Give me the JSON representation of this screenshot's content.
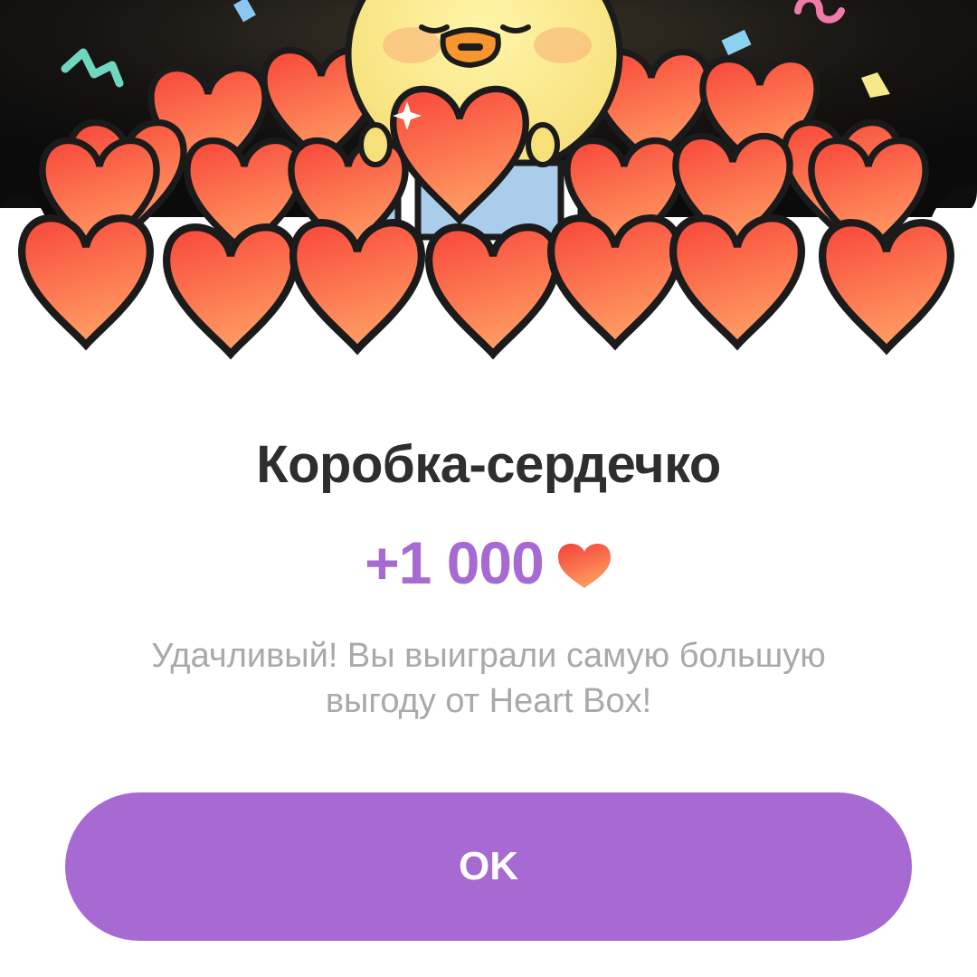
{
  "dialog": {
    "title": "Коробка-сердечко",
    "reward_amount": "+1 000",
    "reward_icon": "heart-icon",
    "message_line1": "Удачливый! Вы выиграли самую большую",
    "message_line2": "выгоду от Heart Box!",
    "ok_label": "OK"
  },
  "colors": {
    "accent": "#a66ad2",
    "title": "#2e2e2e",
    "message": "#a9a9a9",
    "heart": "#f55a42",
    "background_dark": "#111111"
  }
}
